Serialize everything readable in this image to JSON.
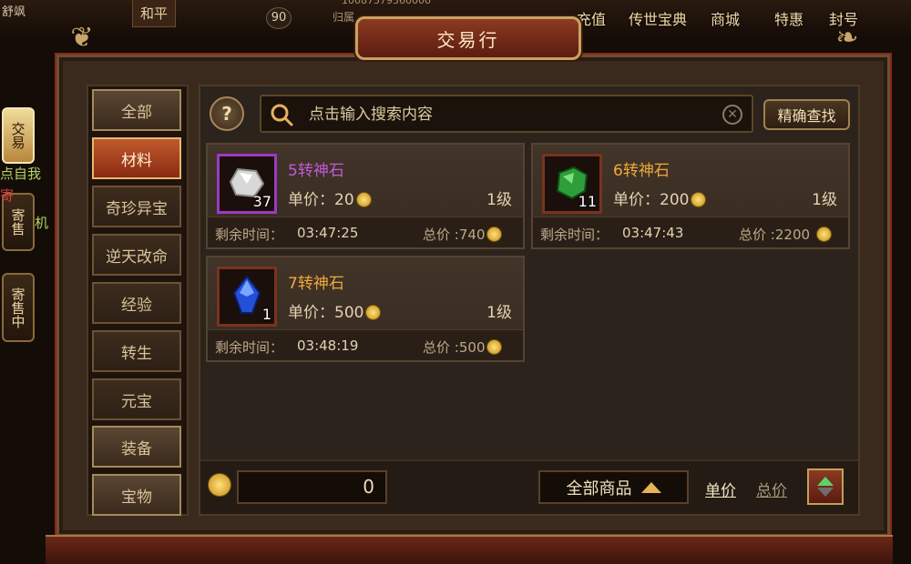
{
  "hud": {
    "left_text": "舒飒",
    "mode_button": "和平",
    "level_badge": "90",
    "id_text": "10087579360000",
    "sub_text": "归属",
    "menu": [
      "充值",
      "传世宝典",
      "商城",
      "特惠",
      "封号"
    ]
  },
  "side_tabs": [
    {
      "label": "交易",
      "active": true
    },
    {
      "label": "寄售",
      "active": false
    },
    {
      "label": "寄售中",
      "active": false
    }
  ],
  "side_texts": [
    "点自我",
    "寄",
    "机"
  ],
  "window": {
    "title": "交易行"
  },
  "categories": [
    {
      "label": "全部",
      "style": "fancy"
    },
    {
      "label": "材料",
      "style": "active"
    },
    {
      "label": "奇珍异宝",
      "style": "normal"
    },
    {
      "label": "逆天改命",
      "style": "normal"
    },
    {
      "label": "经验",
      "style": "normal"
    },
    {
      "label": "转生",
      "style": "normal"
    },
    {
      "label": "元宝",
      "style": "normal"
    },
    {
      "label": "装备",
      "style": "fancy"
    },
    {
      "label": "宝物",
      "style": "fancy"
    }
  ],
  "search": {
    "help_label": "?",
    "placeholder": "点击输入搜索内容",
    "value": "",
    "exact_button": "精确查找"
  },
  "items": [
    {
      "name": "5转神石",
      "name_color": "#c05ad8",
      "icon": "white-stone-icon",
      "quantity": "37",
      "price_label": "单价：",
      "price": "20",
      "level": "1级",
      "time_label": "剩余时间：",
      "time": "03:47:25",
      "total_label": "总价",
      "total": ":740"
    },
    {
      "name": "6转神石",
      "name_color": "#f0a83c",
      "icon": "green-stone-icon",
      "quantity": "11",
      "price_label": "单价：",
      "price": "200",
      "level": "1级",
      "time_label": "剩余时间：",
      "time": "03:47:43",
      "total_label": "总价",
      "total": ":2200"
    },
    {
      "name": "7转神石",
      "name_color": "#f0a83c",
      "icon": "blue-stone-icon",
      "quantity": "1",
      "price_label": "单价：",
      "price": "500",
      "level": "1级",
      "time_label": "剩余时间：",
      "time": "03:48:19",
      "total_label": "总价",
      "total": ":500"
    }
  ],
  "footer": {
    "balance": "0",
    "filter_label": "全部商品",
    "sort_unit": "单价",
    "sort_total": "总价"
  },
  "colors": {
    "accent": "#e6b25a",
    "active_tab": "#b8863d",
    "frame_red": "#8b2618"
  }
}
